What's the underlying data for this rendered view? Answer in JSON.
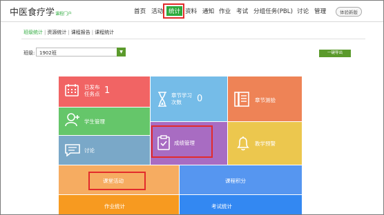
{
  "header": {
    "logo_main": "中医食疗学",
    "logo_sub": "课程门户",
    "nav": [
      "首页",
      "活动",
      "统计",
      "资料",
      "通知",
      "作业",
      "考试",
      "分组任务(PBL)",
      "讨论",
      "管理"
    ],
    "trial_badge": "体验新版"
  },
  "subtabs": [
    "班级统计",
    "资源统计",
    "课程报告",
    "课程统计"
  ],
  "class_selector": {
    "label": "班级:",
    "value": "1902班"
  },
  "export_button": "一键导出",
  "tiles": {
    "published_points": {
      "line1": "已发布",
      "line2": "任务点",
      "count": "1"
    },
    "chapter_learning": {
      "line1": "章节学习",
      "line2": "次数",
      "count": "0"
    },
    "chapter_test": {
      "label": "章节测验"
    },
    "student_management": {
      "label": "学生管理"
    },
    "discussion": {
      "label": "讨论"
    },
    "grade_management": {
      "label": "成绩管理"
    },
    "teaching_alert": {
      "label": "教学预警"
    },
    "class_activity": {
      "label": "课堂活动"
    },
    "course_points": {
      "label": "课程积分"
    },
    "homework_stats": {
      "label": "作业统计"
    },
    "exam_stats": {
      "label": "考试统计"
    }
  },
  "colors": {
    "accent_green": "#2eaa3d",
    "annotation_red": "#e22b2b",
    "tile_red": "#f16464",
    "tile_sky": "#75bce8",
    "tile_orange": "#ee8356",
    "tile_green": "#65c66a",
    "tile_steel": "#7aa8c8",
    "tile_purple": "#a86cc2",
    "tile_yellow": "#ecc74e",
    "tile_peach": "#f6ac61",
    "tile_blue": "#5696f0",
    "tile_deep_orange": "#f79a20",
    "tile_royal": "#3388f2"
  }
}
